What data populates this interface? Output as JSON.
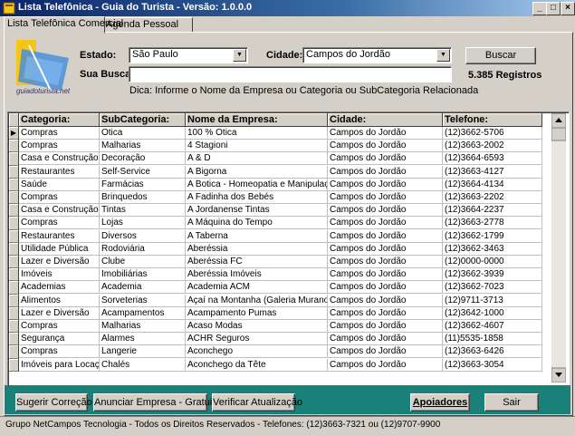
{
  "window": {
    "title": "Lista Telefônica - Guia do Turista - Versão: 1.0.0.0",
    "min": "_",
    "max": "□",
    "close": "×"
  },
  "tabs": [
    {
      "label": "Lista Telefônica Comercial",
      "active": true
    },
    {
      "label": "Agenda Pessoal",
      "active": false
    }
  ],
  "logo": {
    "text": "guiadoturista.net"
  },
  "search": {
    "estado_label": "Estado:",
    "estado_value": "São Paulo",
    "cidade_label": "Cidade:",
    "cidade_value": "Campos do Jordão",
    "busca_label": "Sua Busca:",
    "busca_value": "",
    "buscar_button": "Buscar",
    "registros": "5.385 Registros",
    "hint": "Dica: Informe o Nome da Empresa ou Categoria ou SubCategoria Relacionada"
  },
  "table": {
    "columns": [
      "Categoria:",
      "SubCategoria:",
      "Nome da Empresa:",
      "Cidade:",
      "Telefone:"
    ],
    "rows": [
      [
        "Compras",
        "Otica",
        "100 % Otica",
        "Campos do Jordão",
        "(12)3662-5706"
      ],
      [
        "Compras",
        "Malharias",
        "4 Stagioni",
        "Campos do Jordão",
        "(12)3663-2002"
      ],
      [
        "Casa e Construção",
        "Decoração",
        "A & D",
        "Campos do Jordão",
        "(12)3664-6593"
      ],
      [
        "Restaurantes",
        "Self-Service",
        "A Bigorna",
        "Campos do Jordão",
        "(12)3663-4127"
      ],
      [
        "Saúde",
        "Farmácias",
        "A Botica - Homeopatia e Manipulação",
        "Campos do Jordão",
        "(12)3664-4134"
      ],
      [
        "Compras",
        "Brinquedos",
        "A Fadinha dos Bebés",
        "Campos do Jordão",
        "(12)3663-2202"
      ],
      [
        "Casa e Construção",
        "Tintas",
        "A Jordanense Tintas",
        "Campos do Jordão",
        "(12)3664-2237"
      ],
      [
        "Compras",
        "Lojas",
        "A Máquina do Tempo",
        "Campos do Jordão",
        "(12)3663-2778"
      ],
      [
        "Restaurantes",
        "Diversos",
        "A Taberna",
        "Campos do Jordão",
        "(12)3662-1799"
      ],
      [
        "Utilidade Pública",
        "Rodoviária",
        "Aberéssia",
        "Campos do Jordão",
        "(12)3662-3463"
      ],
      [
        "Lazer e Diversão",
        "Clube",
        "Aberéssia FC",
        "Campos do Jordão",
        "(12)0000-0000"
      ],
      [
        "Imóveis",
        "Imobiliárias",
        "Aberéssia Imóveis",
        "Campos do Jordão",
        "(12)3662-3939"
      ],
      [
        "Academias",
        "Academia",
        "Academia ACM",
        "Campos do Jordão",
        "(12)3662-7023"
      ],
      [
        "Alimentos",
        "Sorveterias",
        "Açaí na Montanha (Galeria Murano)",
        "Campos do Jordão",
        "(12)9711-3713"
      ],
      [
        "Lazer e Diversão",
        "Acampamentos",
        "Acampamento Pumas",
        "Campos do Jordão",
        "(12)3642-1000"
      ],
      [
        "Compras",
        "Malharias",
        "Acaso Modas",
        "Campos do Jordão",
        "(12)3662-4607"
      ],
      [
        "Segurança",
        "Alarmes",
        "ACHR Seguros",
        "Campos do Jordão",
        "(11)5535-1858"
      ],
      [
        "Compras",
        "Langerie",
        "Aconchego",
        "Campos do Jordão",
        "(12)3663-6426"
      ],
      [
        "Imóveis para Locação",
        "Chalés",
        "Aconchego da Tête",
        "Campos do Jordão",
        "(12)3663-3054"
      ]
    ],
    "row_indicator": "▶"
  },
  "footer": {
    "sugerir": "Sugerir Correção",
    "anunciar": "Anunciar Empresa - Gratuito",
    "verificar": "Verificar Atualização",
    "apoiadores": "Apoiadores",
    "sair": "Sair"
  },
  "status": "Grupo NetCampos Tecnologia - Todos os Direitos Reservados - Telefones: (12)3663-7321 ou (12)9707-9900",
  "colors": {
    "footer_bg": "#1a807a",
    "title_start": "#0a246a"
  }
}
